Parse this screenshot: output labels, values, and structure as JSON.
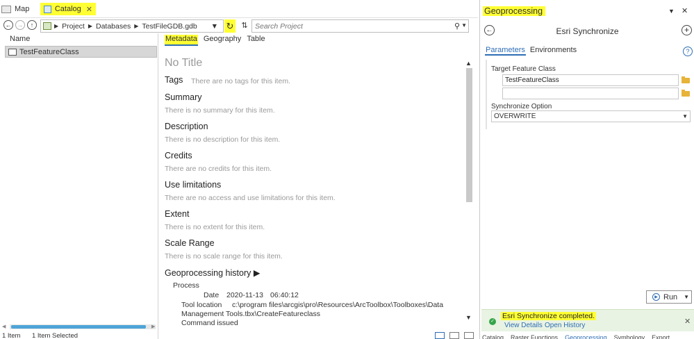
{
  "tabs": {
    "map": "Map",
    "catalog": "Catalog",
    "close": "✕"
  },
  "nav": {
    "path": [
      "Project",
      "Databases",
      "TestFileGDB.gdb"
    ],
    "search_placeholder": "Search Project"
  },
  "list": {
    "column_name": "Name",
    "item": "TestFeatureClass",
    "status_count": "1 Item",
    "status_selected": "1 Item Selected"
  },
  "metadata": {
    "tabs": [
      "Metadata",
      "Geography",
      "Table"
    ],
    "title": "No Title",
    "sections": [
      {
        "heading": "Tags",
        "text": "There are no tags for this item."
      },
      {
        "heading": "Summary",
        "text": "There is no summary for this item."
      },
      {
        "heading": "Description",
        "text": "There is no description for this item."
      },
      {
        "heading": "Credits",
        "text": "There are no credits for this item."
      },
      {
        "heading": "Use limitations",
        "text": "There are no access and use limitations for this item."
      },
      {
        "heading": "Extent",
        "text": "There is no extent for this item."
      },
      {
        "heading": "Scale Range",
        "text": "There is no scale range for this item."
      }
    ],
    "gp_history": {
      "heading": "Geoprocessing history ▶",
      "process": "Process",
      "date_label": "Date",
      "date_value": "2020-11-13",
      "time_value": "06:40:12",
      "tool_location_label": "Tool location",
      "tool_location_line1": "c:\\program files\\arcgis\\pro\\Resources\\ArcToolbox\\Toolboxes\\Data",
      "tool_location_line2": "Management Tools.tbx\\CreateFeatureclass",
      "command_issued": "Command issued"
    }
  },
  "geoprocessing": {
    "title": "Geoprocessing",
    "tool_name": "Esri Synchronize",
    "tab_parameters": "Parameters",
    "tab_environments": "Environments",
    "target_label": "Target Feature Class",
    "target_value": "TestFeatureClass",
    "target_value2": "",
    "sync_label": "Synchronize Option",
    "sync_value": "OVERWRITE",
    "run_label": "Run",
    "message": "Esri Synchronize completed.",
    "view_details": "View Details",
    "open_history": "Open History",
    "bottom_tabs": [
      "Catalog",
      "Raster Functions",
      "Geoprocessing",
      "Symbology",
      "Export"
    ]
  },
  "colors": {
    "highlight": "#ffff33",
    "accent": "#2d6db5",
    "success": "#35a54a"
  }
}
